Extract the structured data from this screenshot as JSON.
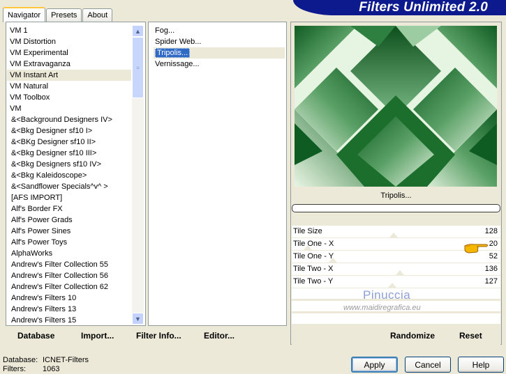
{
  "tabs": [
    "Navigator",
    "Presets",
    "About"
  ],
  "app_title": "Filters Unlimited 2.0",
  "categories": [
    "VM 1",
    "VM Distortion",
    "VM Experimental",
    "VM Extravaganza",
    "VM Instant Art",
    "VM Natural",
    "VM Toolbox",
    "VM",
    "&<Background Designers IV>",
    "&<Bkg Designer sf10 I>",
    "&<BKg Designer sf10 II>",
    "&<Bkg Designer sf10 III>",
    "&<Bkg Designers sf10 IV>",
    "&<Bkg Kaleidoscope>",
    "&<Sandflower Specials^v^ >",
    "[AFS IMPORT]",
    "Alf's Border FX",
    "Alf's Power Grads",
    "Alf's Power Sines",
    "Alf's Power Toys",
    "AlphaWorks",
    "Andrew's Filter Collection 55",
    "Andrew's Filter Collection 56",
    "Andrew's Filter Collection 62",
    "Andrew's Filters 10",
    "Andrew's Filters 13",
    "Andrew's Filters 15"
  ],
  "selected_category": "VM Instant Art",
  "filters": [
    "Fog...",
    "Spider Web...",
    "Tripolis...",
    "Vernissage..."
  ],
  "selected_filter": "Tripolis...",
  "left_buttons": {
    "database": "Database",
    "import": "Import...",
    "filter_info": "Filter Info...",
    "editor": "Editor..."
  },
  "filter_name_label": "Tripolis...",
  "progress": 0,
  "params": [
    {
      "name": "Tile Size",
      "value": "128",
      "level": 128
    },
    {
      "name": "Tile One - X",
      "value": "20",
      "level": 20
    },
    {
      "name": "Tile One - Y",
      "value": "52",
      "level": 52
    },
    {
      "name": "Tile Two - X",
      "value": "136",
      "level": 136
    },
    {
      "name": "Tile Two - Y",
      "value": "127",
      "level": 127
    }
  ],
  "watermark": {
    "name": "Pinuccia",
    "url": "www.maidiregrafica.eu"
  },
  "right_buttons": {
    "randomize": "Randomize",
    "reset": "Reset"
  },
  "footer": {
    "database_label": "Database:",
    "database_value": "ICNET-Filters",
    "filters_label": "Filters:",
    "filters_value": "1063"
  },
  "dialog_buttons": {
    "apply": "Apply",
    "cancel": "Cancel",
    "help": "Help"
  },
  "colors": {
    "accent": "#316ac5",
    "brand": "#0c1a8e",
    "preview_dark": "#1a6b2a",
    "preview_light": "#e8f5e3"
  },
  "icons": [
    "scroll-up-icon",
    "scroll-down-icon",
    "pointing-hand-icon"
  ]
}
